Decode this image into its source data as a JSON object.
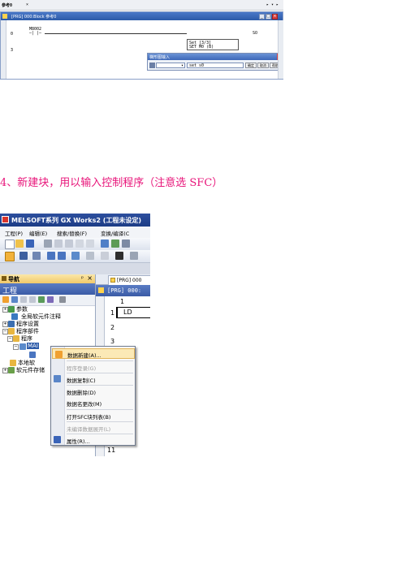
{
  "shot1": {
    "topbar_label": "参考0",
    "window_title": "[PRG] 000:Block 参考0",
    "contact_label": "M8002",
    "row0": "0",
    "row3": "3",
    "coil_line1": "Set [3/3]",
    "coil_line2": "SET  M0 (B)",
    "coil_suffix": "SO",
    "dialog_title": "梯形图输入",
    "dialog_input": "set s0",
    "dialog_buttons": [
      "确定",
      "取消",
      "帮助"
    ]
  },
  "caption": "4、新建块，用以输入控制程序（注意选 SFC）",
  "shot2": {
    "title": "MELSOFT系列 GX Works2 (工程未设定)",
    "menu": [
      "工程(P)",
      "编辑(E)",
      "搜索/替换(F)",
      "变换/编译(C"
    ],
    "nav_header": "导航",
    "nav_pin": "ᵖ",
    "nav_close": "×",
    "project_label": "工程",
    "tree": [
      "参数",
      "全局软元件注释",
      "程序设置",
      "程序部件",
      "程序",
      "MAI",
      "本地软",
      "软元件存储"
    ],
    "tab_label": "[PRG] 000",
    "doc_title": "[PRG] 000:",
    "line_numbers": [
      "1",
      "1",
      "2",
      "3",
      "11"
    ],
    "ld_text": "LD",
    "context_menu": [
      {
        "label": "数据新建(A)...",
        "state": "highlighted"
      },
      {
        "label": "程序登录(G)",
        "state": "disabled"
      },
      {
        "label": "数据复制(C)",
        "state": "normal"
      },
      {
        "label": "数据删除(D)",
        "state": "normal"
      },
      {
        "label": "数据名更改(M)",
        "state": "normal"
      },
      {
        "label": "打开SFC块列表(B)",
        "state": "normal"
      },
      {
        "label": "未编译数据展开(L)",
        "state": "disabled"
      },
      {
        "label": "属性(R)...",
        "state": "normal"
      }
    ]
  },
  "colors": {
    "caption": "#e8157a",
    "title_blue": "#1c3c86",
    "highlight": "#fbe9b6"
  }
}
